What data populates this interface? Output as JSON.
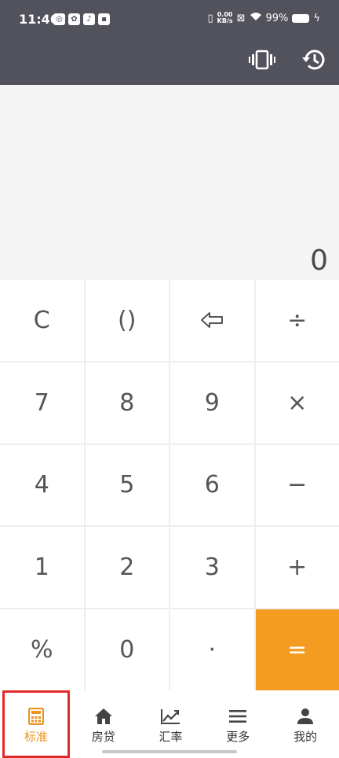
{
  "status_bar": {
    "time": "11:46",
    "net_speed": "0.00",
    "net_unit": "KB/s",
    "battery": "99%"
  },
  "toolbar": {
    "vibrate_icon": "vibrate-icon",
    "history_icon": "history-icon"
  },
  "display": {
    "value": "0"
  },
  "keys": {
    "clear": "C",
    "parens": "()",
    "divide": "÷",
    "seven": "7",
    "eight": "8",
    "nine": "9",
    "multiply": "×",
    "four": "4",
    "five": "5",
    "six": "6",
    "minus": "−",
    "one": "1",
    "two": "2",
    "three": "3",
    "plus": "+",
    "percent": "%",
    "zero": "0",
    "dot": "·",
    "equals": "="
  },
  "nav": {
    "standard": "标准",
    "mortgage": "房贷",
    "exchange": "汇率",
    "more": "更多",
    "mine": "我的"
  },
  "colors": {
    "topbar": "#51525c",
    "accent": "#f49b22",
    "active_tab": "#e8941f",
    "highlight_border": "#e02a2a"
  }
}
